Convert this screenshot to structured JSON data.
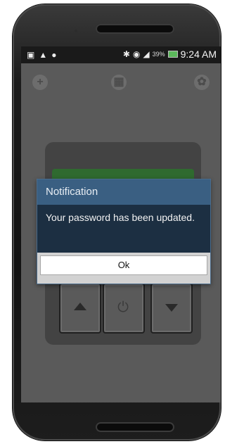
{
  "statusbar": {
    "left_icons": [
      "image-icon",
      "warning-icon",
      "hangouts-icon"
    ],
    "right_icons": [
      "bluetooth-icon",
      "wifi-icon",
      "signal-icon"
    ],
    "battery_percent": "39%",
    "time": "9:24 AM"
  },
  "app": {
    "top_buttons": [
      "add-icon",
      "grid-icon",
      "settings-icon"
    ]
  },
  "dialog": {
    "title": "Notification",
    "message": "Your password has been updated.",
    "ok_label": "Ok"
  },
  "colors": {
    "dialog_title_bg": "#3a5f82",
    "dialog_body_bg": "#1c2f42",
    "display_green": "#2f6a2f"
  }
}
